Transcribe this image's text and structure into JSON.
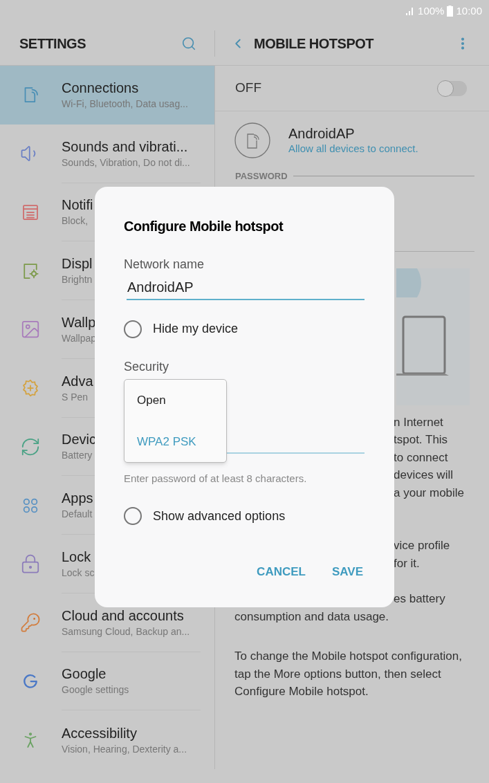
{
  "status_bar": {
    "battery": "100%",
    "time": "10:00"
  },
  "settings_header": {
    "title": "SETTINGS"
  },
  "sidebar": {
    "items": [
      {
        "title": "Connections",
        "subtitle": "Wi-Fi, Bluetooth, Data usag...",
        "selected": true
      },
      {
        "title": "Sounds and vibrati...",
        "subtitle": "Sounds, Vibration, Do not di...",
        "selected": false
      },
      {
        "title": "Notifi",
        "subtitle": "Block,",
        "selected": false
      },
      {
        "title": "Displ",
        "subtitle": "Brightn",
        "selected": false
      },
      {
        "title": "Wallp",
        "subtitle": "Wallpap",
        "selected": false
      },
      {
        "title": "Adva",
        "subtitle": "S Pen",
        "selected": false
      },
      {
        "title": "Devic",
        "subtitle": "Battery",
        "selected": false
      },
      {
        "title": "Apps",
        "subtitle": "Default",
        "selected": false
      },
      {
        "title": "Lock",
        "subtitle": "Lock sc",
        "selected": false
      },
      {
        "title": "Cloud and accounts",
        "subtitle": "Samsung Cloud, Backup an...",
        "selected": false
      },
      {
        "title": "Google",
        "subtitle": "Google settings",
        "selected": false
      },
      {
        "title": "Accessibility",
        "subtitle": "Vision, Hearing, Dexterity a...",
        "selected": false
      }
    ]
  },
  "hotspot": {
    "title": "MOBILE HOTSPOT",
    "switch": {
      "label": "OFF",
      "on": false
    },
    "network": {
      "name": "AndroidAP",
      "status": "Allow all devices to connect."
    },
    "password_section": "PASSWORD",
    "description_lines": [
      "n Internet",
      "tspot. This",
      "to connect",
      "devices will",
      "a your mobile"
    ],
    "profile_lines": [
      "vice profile",
      "for it."
    ],
    "battery_lines": [
      "es battery"
    ],
    "battery_line_full": "consumption and data usage.",
    "change_note": "To change the Mobile hotspot configuration, tap the More options button, then select Configure Mobile hotspot."
  },
  "dialog": {
    "title": "Configure Mobile hotspot",
    "network_name": {
      "label": "Network name",
      "value": "AndroidAP"
    },
    "hide_device": {
      "label": "Hide my device",
      "checked": false
    },
    "security": {
      "label": "Security",
      "options": [
        {
          "label": "Open",
          "selected": false
        },
        {
          "label": "WPA2 PSK",
          "selected": true
        }
      ]
    },
    "password_hint": "Enter password of at least 8 characters.",
    "advanced": {
      "label": "Show advanced options",
      "checked": false
    },
    "buttons": [
      "CANCEL",
      "SAVE"
    ]
  }
}
